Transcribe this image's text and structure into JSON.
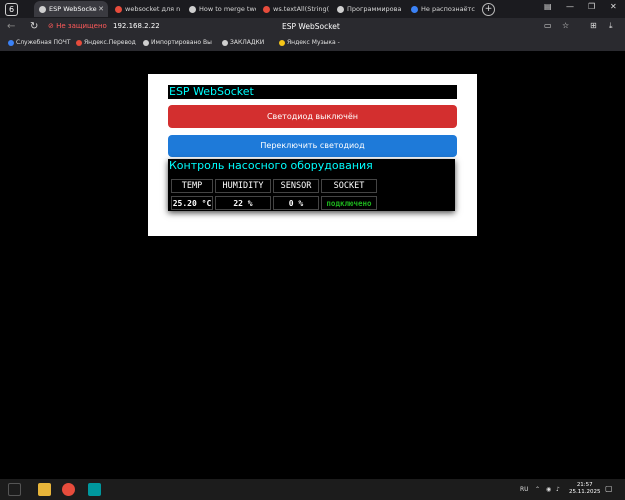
{
  "browser": {
    "tab_count": "6",
    "tabs": [
      {
        "label": "ESP WebSocke",
        "icon": "esp-page-icon",
        "color": "#cfcfcf"
      },
      {
        "label": "websocket для n",
        "icon": "yandex-search-icon",
        "color": "#e74c3c"
      },
      {
        "label": "How to merge two",
        "icon": "arduino-forum-icon",
        "color": "#cfcfcf"
      },
      {
        "label": "ws.textAll(String(",
        "icon": "yandex-search-icon",
        "color": "#e74c3c"
      },
      {
        "label": "Программирова",
        "icon": "ai-assistant-icon",
        "color": "#cfcfcf"
      },
      {
        "label": "Не распознаётс",
        "icon": "ai-assistant-icon",
        "color": "#3b82f6"
      }
    ],
    "security_label": "Не защищено",
    "url": "192.168.2.22",
    "page_title": "ESP WebSocket",
    "bookmarks": [
      {
        "label": "Служебная ПОЧТ",
        "color": "#3b82f6"
      },
      {
        "label": "Яндекс.Перевод",
        "color": "#e74c3c"
      },
      {
        "label": "Импортировано Вы",
        "color": "#cfcfcf"
      },
      {
        "label": "ЗАКЛАДКИ",
        "color": "#cfcfcf"
      },
      {
        "label": "Яндекс Музыка -",
        "color": "#f5c518"
      }
    ]
  },
  "page": {
    "header": "ESP WebSocket",
    "led_status_button": "Светодиод выключён",
    "toggle_button": "Переключить светодиод",
    "panel_title": "Контроль насосного оборудования",
    "table": {
      "headers": [
        "TEMP",
        "HUMIDITY",
        "SENSOR",
        "SOCKET"
      ],
      "values": [
        "25.20 °C",
        "22 %",
        "0 %",
        "подключено"
      ]
    },
    "colors": {
      "accent_cyan": "#00ffff",
      "button_red": "#d32f2f",
      "button_blue": "#1e7ad9",
      "status_green": "#1db31d"
    }
  },
  "taskbar": {
    "language": "RU",
    "time": "21:57",
    "date": "25.11.2025"
  }
}
